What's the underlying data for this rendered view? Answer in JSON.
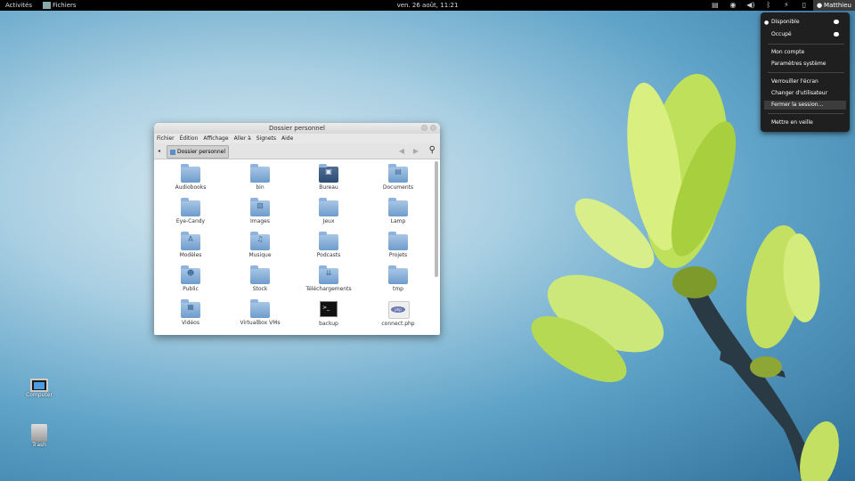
{
  "topbar": {
    "activities": "Activités",
    "app_name": "Fichiers",
    "clock": "ven. 26 août, 11:21",
    "user": "Matthieu"
  },
  "user_menu": {
    "items": [
      {
        "label": "Disponible"
      },
      {
        "label": "Occupé"
      },
      {
        "label": "Mon compte"
      },
      {
        "label": "Paramètres système"
      },
      {
        "label": "Verrouiller l'écran"
      },
      {
        "label": "Changer d'utilisateur"
      },
      {
        "label": "Fermer la session..."
      },
      {
        "label": "Mettre en veille"
      }
    ]
  },
  "window": {
    "title": "Dossier personnel",
    "menu": [
      "Fichier",
      "Édition",
      "Affichage",
      "Aller à",
      "Signets",
      "Aide"
    ],
    "breadcrumb": "Dossier personnel",
    "files": [
      {
        "name": "Audiobooks"
      },
      {
        "name": "bin"
      },
      {
        "name": "Bureau"
      },
      {
        "name": "Documents"
      },
      {
        "name": "Eye-Candy"
      },
      {
        "name": "Images"
      },
      {
        "name": "Jeux"
      },
      {
        "name": "Lamp"
      },
      {
        "name": "Modèles"
      },
      {
        "name": "Musique"
      },
      {
        "name": "Podcasts"
      },
      {
        "name": "Projets"
      },
      {
        "name": "Public"
      },
      {
        "name": "Stock"
      },
      {
        "name": "Téléchargements"
      },
      {
        "name": "tmp"
      },
      {
        "name": "Vidéos"
      },
      {
        "name": "VirtualBox VMs"
      },
      {
        "name": "backup"
      },
      {
        "name": "connect.php"
      }
    ]
  },
  "desktop": {
    "icons": [
      {
        "label": "Computer"
      },
      {
        "label": "Trash"
      }
    ]
  }
}
